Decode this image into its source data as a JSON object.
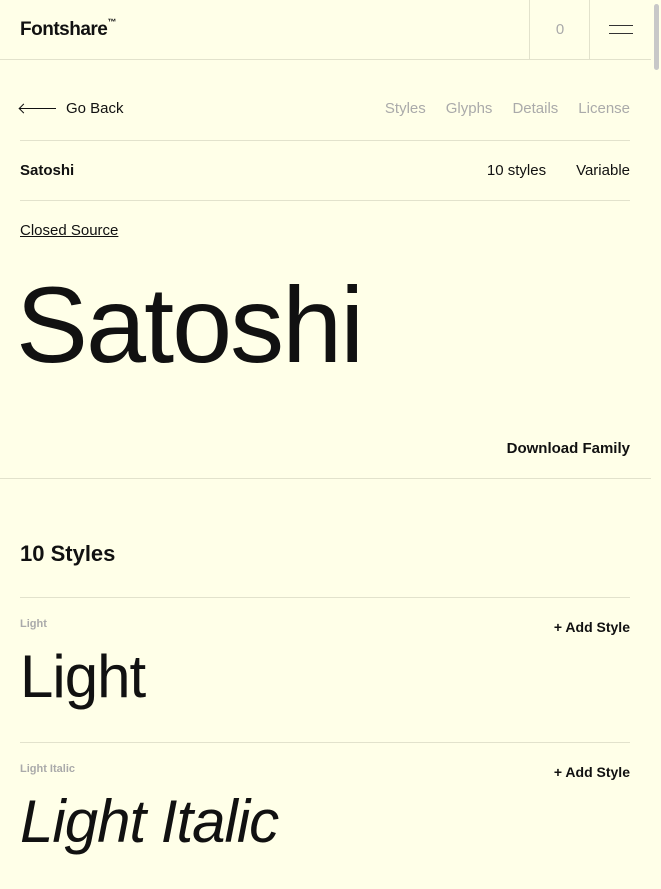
{
  "header": {
    "logo": "Fontshare",
    "trademark": "™",
    "cart_count": "0",
    "menu_icon": "hamburger-menu-icon"
  },
  "subnav": {
    "back_label": "Go Back",
    "tabs": [
      "Styles",
      "Glyphs",
      "Details",
      "License"
    ]
  },
  "info": {
    "name": "Satoshi",
    "styles_count": "10 styles",
    "variable": "Variable"
  },
  "license_label": "Closed Source",
  "hero_text": "Satoshi",
  "download_label": "Download Family",
  "styles_heading": "10 Styles",
  "styles": [
    {
      "label": "Light",
      "sample": "Light",
      "add": "+ Add Style"
    },
    {
      "label": "Light Italic",
      "sample": "Light Italic",
      "add": "+ Add Style"
    }
  ],
  "colors": {
    "background": "#ffffe8",
    "text": "#111111",
    "muted": "#aaaaaa",
    "border": "#e2e2cc"
  }
}
